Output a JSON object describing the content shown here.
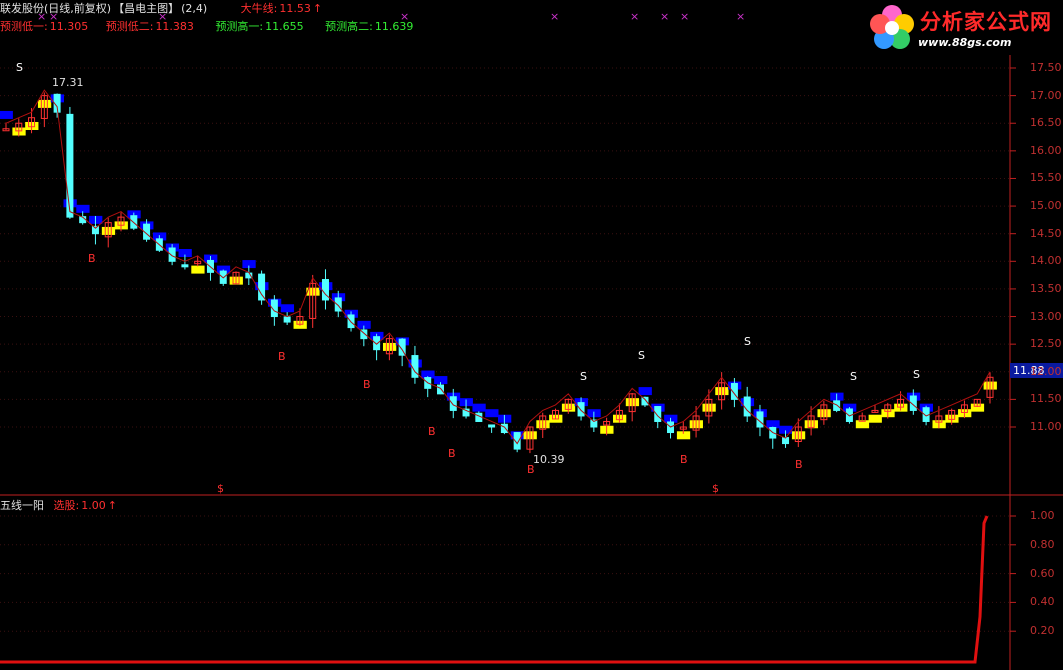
{
  "header": {
    "stock_title": "联发股份(日线,前复权)",
    "template_name": "【昌电主图】",
    "params": "(2,4)",
    "bull_line_label": "大牛线:",
    "bull_line_value": "11.53",
    "pred_low1_label": "预测低一:",
    "pred_low1_value": "11.305",
    "pred_low2_label": "预测低二:",
    "pred_low2_value": "11.383",
    "pred_high1_label": "预测高一:",
    "pred_high1_value": "11.655",
    "pred_high2_label": "预测高二:",
    "pred_high2_value": "11.639",
    "up_arrow": "↑"
  },
  "logo": {
    "title": "分析家公式网",
    "url": "www.88gs.com"
  },
  "price_axis": {
    "ticks": [
      "17.50",
      "17.00",
      "16.50",
      "16.00",
      "15.50",
      "15.00",
      "14.50",
      "14.00",
      "13.50",
      "13.00",
      "12.50",
      "12.00",
      "11.50",
      "11.00"
    ],
    "current_price": "11.88"
  },
  "annotations": {
    "high_label": "17.31",
    "low_label": "10.39",
    "buy": "B",
    "sell": "S",
    "dollar": "$",
    "cross": "×"
  },
  "sub_panel": {
    "indicator_name": "五线一阳",
    "select_label": "选股:",
    "select_value": "1.00",
    "up_arrow": "↑",
    "ticks": [
      "1.00",
      "0.80",
      "0.60",
      "0.40",
      "0.20"
    ]
  },
  "colors": {
    "up_candle": "#ff3232",
    "down_candle": "#54ffff",
    "bull_line_rising": "#ffff00",
    "bull_line_falling": "#0000ff",
    "signal_red": "#ff3030",
    "axis_red": "#c02020",
    "highlight_green": "#33ee33"
  },
  "chart_data": {
    "type": "candlestick",
    "ylim": [
      10.2,
      17.7
    ],
    "approx_close_path": [
      16.4,
      16.5,
      16.6,
      17.0,
      16.7,
      14.8,
      14.7,
      14.5,
      14.7,
      14.8,
      14.6,
      14.4,
      14.2,
      14.0,
      13.9,
      14.0,
      13.8,
      13.6,
      13.8,
      13.7,
      13.3,
      13.0,
      12.9,
      13.0,
      13.6,
      13.3,
      13.1,
      12.8,
      12.6,
      12.4,
      12.6,
      12.3,
      11.9,
      11.7,
      11.6,
      11.3,
      11.2,
      11.1,
      11.0,
      10.9,
      10.6,
      11.0,
      11.2,
      11.3,
      11.5,
      11.2,
      11.0,
      11.1,
      11.3,
      11.6,
      11.4,
      11.1,
      10.9,
      11.0,
      11.2,
      11.5,
      11.8,
      11.5,
      11.2,
      11.0,
      10.8,
      10.7,
      11.0,
      11.2,
      11.4,
      11.3,
      11.1,
      11.2,
      11.3,
      11.4,
      11.5,
      11.3,
      11.1,
      11.2,
      11.3,
      11.4,
      11.5,
      11.9
    ],
    "sub_indicator": {
      "name": "五线一阳",
      "values_end": [
        0,
        0,
        1.0
      ]
    }
  }
}
